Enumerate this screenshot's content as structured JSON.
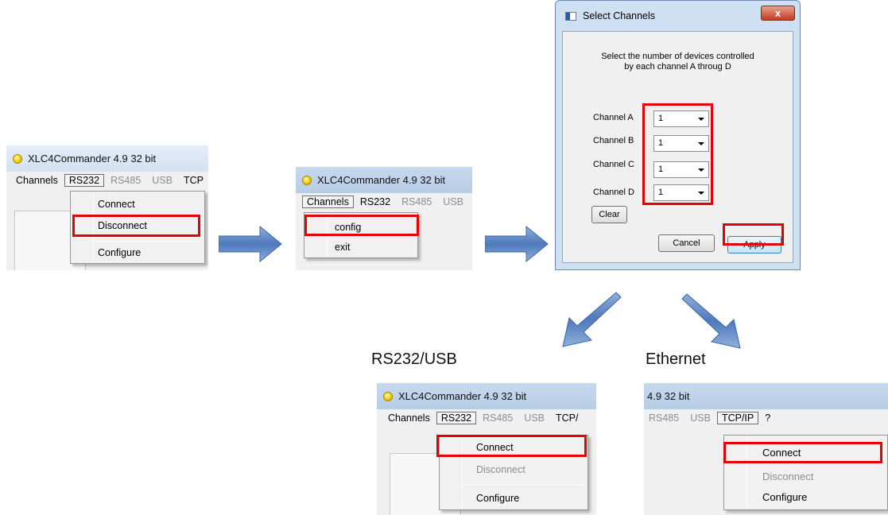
{
  "panel1": {
    "title": "XLC4Commander 4.9 32 bit",
    "menu": [
      "Channels",
      "RS232",
      "RS485",
      "USB",
      "TCP"
    ],
    "dropdown": [
      "Connect",
      "Disconnect",
      "Configure"
    ]
  },
  "panel2": {
    "title": "XLC4Commander 4.9 32 bit",
    "menu": [
      "Channels",
      "RS232",
      "RS485",
      "USB"
    ],
    "dropdown": [
      "config",
      "exit"
    ]
  },
  "dialog": {
    "title": "Select Channels",
    "close": "x",
    "description_line1": "Select the number of devices controlled",
    "description_line2": "by each channel A throug D",
    "channels": [
      {
        "label": "Channel A",
        "value": "1"
      },
      {
        "label": "Channel B",
        "value": "1"
      },
      {
        "label": "Channel C",
        "value": "1"
      },
      {
        "label": "Channel D",
        "value": "1"
      }
    ],
    "clear": "Clear",
    "cancel": "Cancel",
    "apply": "Apply"
  },
  "captions": {
    "left": "RS232/USB",
    "right": "Ethernet"
  },
  "panel4": {
    "title": "XLC4Commander 4.9 32 bit",
    "menu": [
      "Channels",
      "RS232",
      "RS485",
      "USB",
      "TCP/"
    ],
    "dropdown": [
      "Connect",
      "Disconnect",
      "Configure"
    ]
  },
  "panel5": {
    "title": "4.9 32 bit",
    "menu": [
      "RS485",
      "USB",
      "TCP/IP",
      "?"
    ],
    "dropdown": [
      "Connect",
      "Disconnect",
      "Configure"
    ]
  },
  "colors": {
    "highlight": "#e20000",
    "arrow": "#5b82bf"
  }
}
